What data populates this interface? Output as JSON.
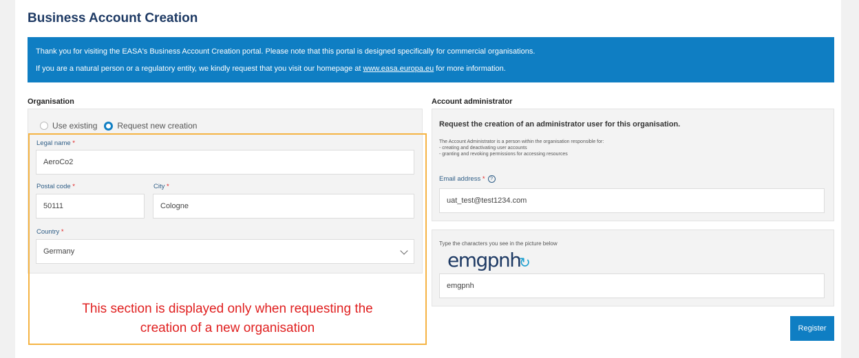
{
  "page": {
    "title": "Business Account Creation"
  },
  "banner": {
    "line1": "Thank you for visiting the EASA's Business Account Creation portal. Please note that this portal is designed specifically for commercial organisations.",
    "line2_pre": "If you are a natural person or a regulatory entity, we kindly request that you visit our homepage at ",
    "line2_link": "www.easa.europa.eu",
    "line2_post": " for more information."
  },
  "organisation": {
    "section_label": "Organisation",
    "radio_existing": "Use existing",
    "radio_new": "Request new creation",
    "selected": "Request new creation",
    "legal_name_label": "Legal name",
    "legal_name_value": "AeroCo2",
    "postal_code_label": "Postal code",
    "postal_code_value": "50111",
    "city_label": "City",
    "city_value": "Cologne",
    "country_label": "Country",
    "country_value": "Germany",
    "required_marker": "*"
  },
  "callout": {
    "line1": "This section is displayed only when requesting the",
    "line2": "creation of a new organisation",
    "color": "#e02020",
    "border_color": "#f5b342"
  },
  "admin": {
    "section_label": "Account administrator",
    "heading": "Request the creation of an administrator user for this organisation.",
    "desc1": "The Account Administrator is a person within the organisation responsible for:",
    "desc2": "- creating and deactivating user accounts",
    "desc3": "- granting and revoking permissions for accessing resources",
    "email_label": "Email address",
    "email_value": "uat_test@test1234.com",
    "help_glyph": "?"
  },
  "captcha": {
    "label": "Type the characters you see in the picture below",
    "image_text": "emgpnh",
    "input_value": "emgpnh",
    "refresh_glyph": "↻"
  },
  "actions": {
    "register_label": "Register"
  },
  "colors": {
    "accent": "#0f7ec3",
    "title": "#1e3a64"
  }
}
